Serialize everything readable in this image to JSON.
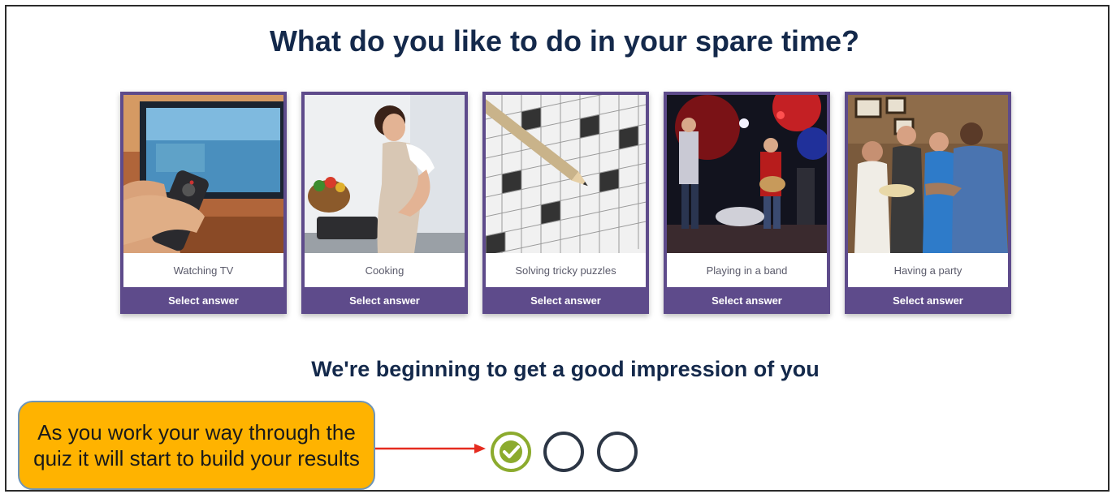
{
  "page": {
    "title": "What do you like to do in your spare time?",
    "subtitle": "We're beginning to get a good impression of you"
  },
  "answers": [
    {
      "label": "Watching TV",
      "button": "Select answer"
    },
    {
      "label": "Cooking",
      "button": "Select answer"
    },
    {
      "label": "Solving tricky puzzles",
      "button": "Select answer"
    },
    {
      "label": "Playing in a band",
      "button": "Select answer"
    },
    {
      "label": "Having a party",
      "button": "Select answer"
    }
  ],
  "progress": {
    "steps_total": 3,
    "steps_completed": 1
  },
  "annotation": {
    "text": "As you work your way through the quiz it will start to build your results"
  },
  "colors": {
    "heading": "#14294b",
    "card_border": "#5e4b8b",
    "check": "#8cab2e",
    "step_empty": "#2c3645",
    "callout_bg": "#ffb300",
    "arrow": "#e52b1f"
  }
}
